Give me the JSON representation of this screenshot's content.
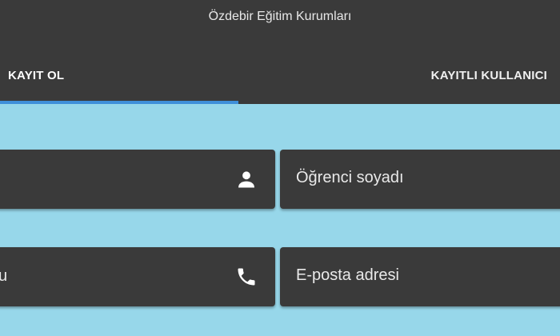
{
  "app": {
    "title": "Özdebir Eğitim Kurumları"
  },
  "tabs": [
    {
      "label": "KAYIT OL",
      "active": true
    },
    {
      "label": "KAYITLI KULLANICI",
      "active": false
    }
  ],
  "form": {
    "student_name": {
      "placeholder": "",
      "icon": "person-icon"
    },
    "student_surname": {
      "placeholder": "Öğrenci soyadı"
    },
    "phone": {
      "placeholder": "u",
      "icon": "phone-icon"
    },
    "email": {
      "placeholder": "E-posta adresi"
    }
  },
  "colors": {
    "background": "#97d7ea",
    "surface": "#3a3a3a",
    "accent": "#3f8fd9",
    "text": "#e9e9e9"
  }
}
